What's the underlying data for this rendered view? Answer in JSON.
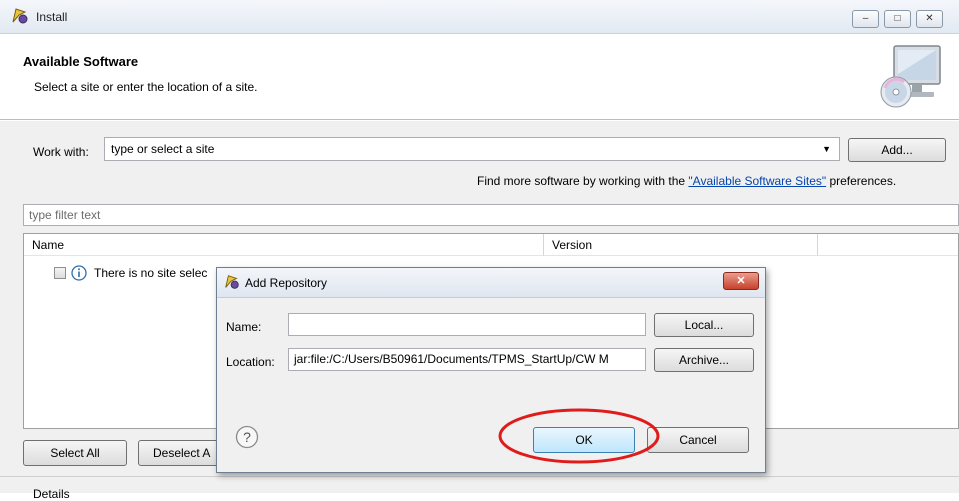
{
  "window": {
    "title": "Install",
    "minimize_glyph": "–",
    "maximize_glyph": "□",
    "close_glyph": "✕"
  },
  "header": {
    "title": "Available Software",
    "subtitle": "Select a site or enter the location of a site."
  },
  "work_with": {
    "label": "Work with:",
    "value": "type or select a site",
    "add_label": "Add..."
  },
  "find_more": {
    "prefix": "Find more software by working with the ",
    "link": "\"Available Software Sites\"",
    "suffix": " preferences."
  },
  "filter": {
    "placeholder": "type filter text"
  },
  "table": {
    "columns": [
      "Name",
      "Version"
    ],
    "rows": [
      {
        "label": "There is no site selec"
      }
    ]
  },
  "buttons": {
    "select_all": "Select All",
    "deselect_all": "Deselect A"
  },
  "details": {
    "label": "Details"
  },
  "dialog": {
    "title": "Add Repository",
    "close_glyph": "✕",
    "name_label": "Name:",
    "name_value": "",
    "location_label": "Location:",
    "location_value": "jar:file:/C:/Users/B50961/Documents/TPMS_StartUp/CW M",
    "local_label": "Local...",
    "archive_label": "Archive...",
    "ok_label": "OK",
    "cancel_label": "Cancel",
    "help_glyph": "?"
  },
  "colors": {
    "link": "#0645ad",
    "highlight_ellipse": "#e01b1b",
    "ok_border": "#3c7fb1"
  },
  "icons": [
    "eclipse-plugin-icon",
    "cd-monitor-icon",
    "info-icon",
    "help-icon",
    "dropdown-arrow-icon"
  ]
}
